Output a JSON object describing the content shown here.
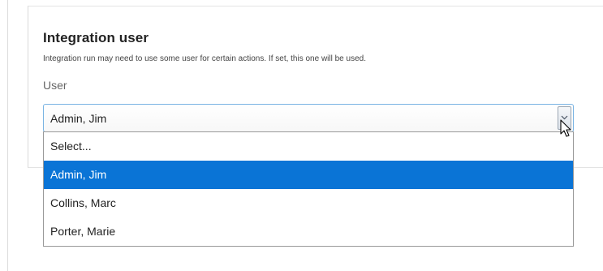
{
  "section": {
    "title": "Integration user",
    "description": "Integration run may need to use some user for certain actions. If set, this one will be used."
  },
  "user_field": {
    "label": "User",
    "selected_value": "Admin, Jim",
    "options": [
      {
        "label": "Select...",
        "selected": false
      },
      {
        "label": "Admin, Jim",
        "selected": true
      },
      {
        "label": "Collins, Marc",
        "selected": false
      },
      {
        "label": "Porter, Marie",
        "selected": false
      }
    ]
  },
  "colors": {
    "selection_highlight": "#0a74d6",
    "focus_border": "#7ab4e3"
  },
  "icons": {
    "dropdown_arrow": "chevron-down-icon",
    "mouse_pointer": "mouse-pointer-icon"
  }
}
